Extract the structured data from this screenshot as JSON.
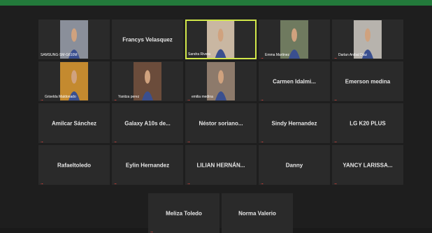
{
  "participants": [
    {
      "name": "SAMSUNG-SM-G610M",
      "has_video": true,
      "muted": false,
      "active": false,
      "bg": "#8a8f9a"
    },
    {
      "name": "Francys Velasquez",
      "has_video": false,
      "muted": false,
      "active": false
    },
    {
      "name": "Sandra Rivera",
      "has_video": true,
      "muted": false,
      "active": true,
      "bg": "#c9b7a2"
    },
    {
      "name": "Emma Martinez",
      "has_video": true,
      "muted": true,
      "active": false,
      "bg": "#6f7a5f"
    },
    {
      "name": "Darlan Anibal Diaz",
      "has_video": true,
      "muted": true,
      "active": false,
      "bg": "#b7b3ad"
    },
    {
      "name": "Griselda Maldonado",
      "has_video": true,
      "muted": true,
      "active": false,
      "bg": "#c48a2f"
    },
    {
      "name": "Yanitza perez",
      "has_video": true,
      "muted": true,
      "active": false,
      "bg": "#6b4c3b"
    },
    {
      "name": "emilia medina",
      "has_video": true,
      "muted": true,
      "active": false,
      "bg": "#8d7a6b"
    },
    {
      "name": "Carmen  Idalmi...",
      "has_video": false,
      "muted": true,
      "active": false
    },
    {
      "name": "Emerson medina",
      "has_video": false,
      "muted": true,
      "active": false
    },
    {
      "name": "Amilcar Sánchez",
      "has_video": false,
      "muted": true,
      "active": false
    },
    {
      "name": "Galaxy A10s de...",
      "has_video": false,
      "muted": true,
      "active": false
    },
    {
      "name": "Néstor  soriano...",
      "has_video": false,
      "muted": true,
      "active": false
    },
    {
      "name": "Sindy Hernandez",
      "has_video": false,
      "muted": true,
      "active": false
    },
    {
      "name": "LG K20 PLUS",
      "has_video": false,
      "muted": true,
      "active": false
    },
    {
      "name": "Rafaeltoledo",
      "has_video": false,
      "muted": true,
      "active": false
    },
    {
      "name": "Eylin Hernandez",
      "has_video": false,
      "muted": true,
      "active": false
    },
    {
      "name": "LILIAN  HERNÁN...",
      "has_video": false,
      "muted": true,
      "active": false
    },
    {
      "name": "Danny",
      "has_video": false,
      "muted": true,
      "active": false
    },
    {
      "name": "YANCY  LARISSA...",
      "has_video": false,
      "muted": true,
      "active": false
    }
  ],
  "last_row": [
    {
      "name": "Meliza Toledo",
      "has_video": false,
      "muted": true,
      "active": false
    },
    {
      "name": "Norma Valerio",
      "has_video": false,
      "muted": false,
      "active": false
    }
  ],
  "colors": {
    "topbar": "#237a3b",
    "active_border": "#d2e84a",
    "muted_icon": "#e0433a"
  }
}
